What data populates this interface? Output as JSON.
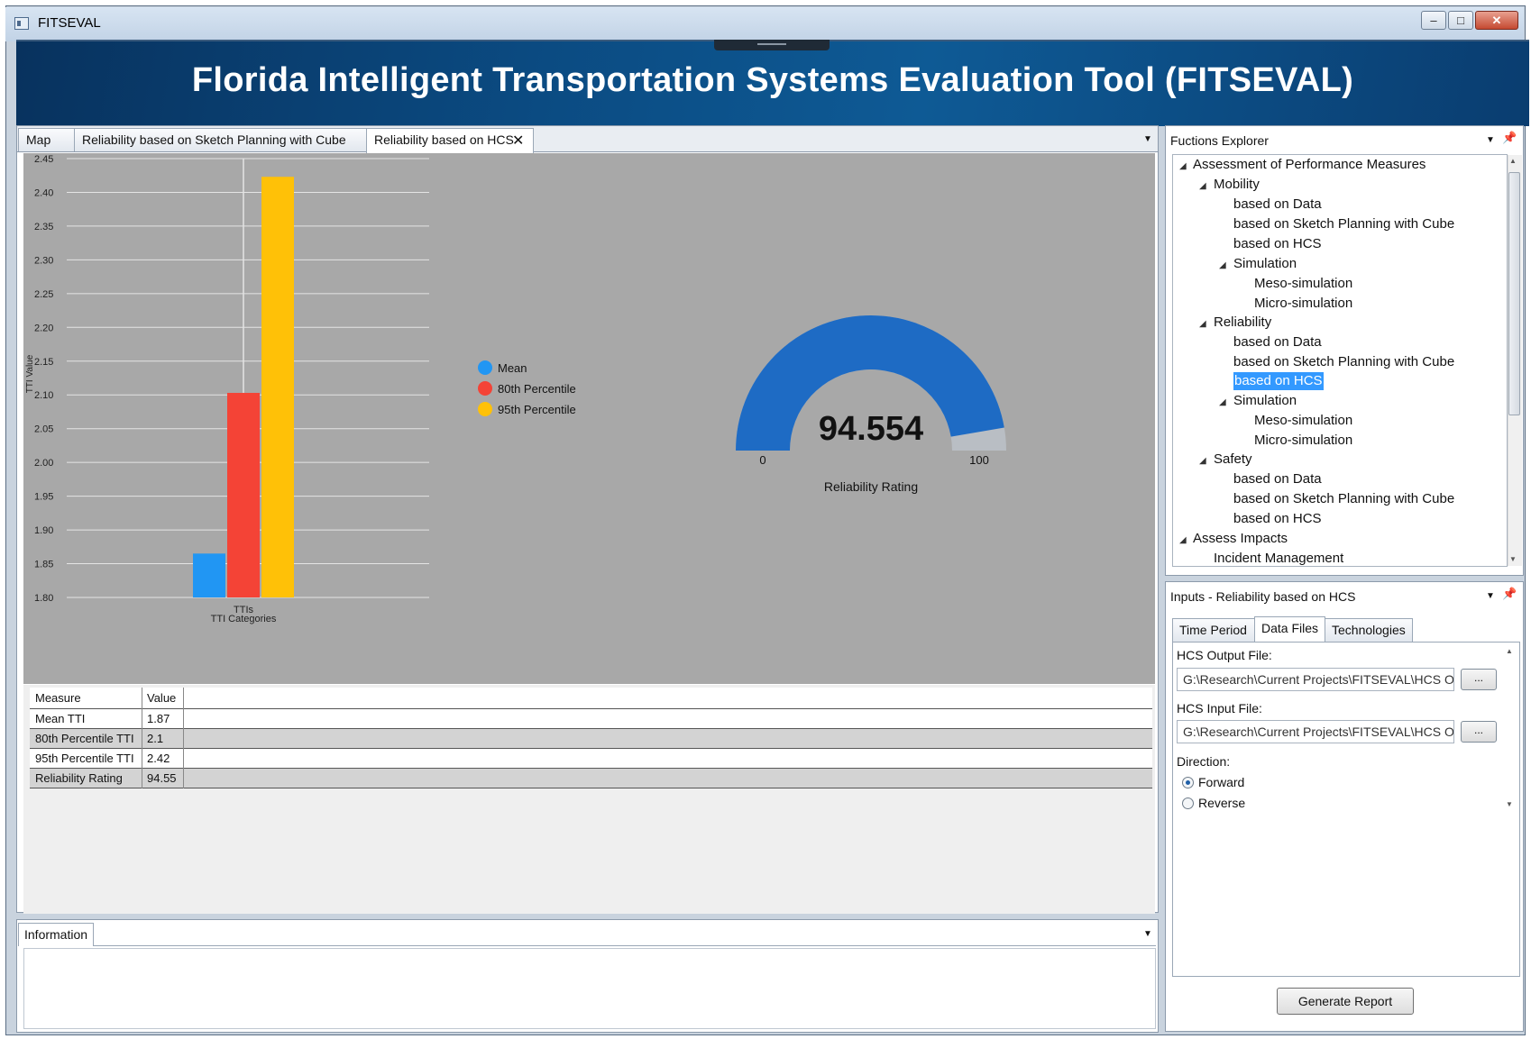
{
  "window": {
    "title": "FITSEVAL",
    "min_label": "‒",
    "max_label": "□",
    "close_label": "✕"
  },
  "banner": {
    "title": "Florida Intelligent Transportation Systems Evaluation Tool (FITSEVAL)"
  },
  "main_tabs": [
    {
      "label": "Map"
    },
    {
      "label": "Reliability based on Sketch Planning with Cube"
    },
    {
      "label": "Reliability based on HCS"
    }
  ],
  "icons": {
    "close": "close-icon",
    "dropdown": "dropdown-icon",
    "pin": "pin-icon"
  },
  "chart_data": {
    "type": "bar",
    "categories": [
      "TTIs"
    ],
    "series": [
      {
        "name": "Mean",
        "values": [
          1.865
        ],
        "color": "#2196f3"
      },
      {
        "name": "80th Percentile",
        "values": [
          2.103
        ],
        "color": "#f44336"
      },
      {
        "name": "95th Percentile",
        "values": [
          2.423
        ],
        "color": "#ffc107"
      }
    ],
    "ylabel": "TTI Value",
    "xlabel": "TTI Categories",
    "ylim": [
      1.8,
      2.45
    ],
    "yticks": [
      "2.45",
      "2.40",
      "2.35",
      "2.30",
      "2.25",
      "2.20",
      "2.15",
      "2.10",
      "2.05",
      "2.00",
      "1.95",
      "1.90",
      "1.85",
      "1.80"
    ],
    "grid": true,
    "legend_placement": "right"
  },
  "gauge": {
    "value_label": "94.554",
    "value": 94.554,
    "min": 0,
    "max": 100,
    "min_label": "0",
    "max_label": "100",
    "caption": "Reliability Rating",
    "fill_color": "#1e6bc4",
    "track_color": "#b9bec4"
  },
  "grid": {
    "columns": [
      "Measure",
      "Value"
    ],
    "rows": [
      {
        "measure": "Mean TTI",
        "value": "1.87"
      },
      {
        "measure": "80th Percentile TTI",
        "value": "2.1"
      },
      {
        "measure": "95th Percentile TTI",
        "value": "2.42"
      },
      {
        "measure": "Reliability Rating",
        "value": "94.55"
      }
    ]
  },
  "info_panel": {
    "tab_label": "Information"
  },
  "explorer": {
    "title": "Fuctions Explorer",
    "items": [
      {
        "label": "Assessment of Performance Measures"
      },
      {
        "label": "Mobility"
      },
      {
        "label": "based on Data"
      },
      {
        "label": "based on Sketch Planning with Cube"
      },
      {
        "label": "based on HCS"
      },
      {
        "label": "Simulation"
      },
      {
        "label": "Meso-simulation"
      },
      {
        "label": "Micro-simulation"
      },
      {
        "label": "Reliability"
      },
      {
        "label": "based on Data"
      },
      {
        "label": "based on Sketch Planning with Cube"
      },
      {
        "label": "based on HCS"
      },
      {
        "label": "Simulation"
      },
      {
        "label": "Meso-simulation"
      },
      {
        "label": "Micro-simulation"
      },
      {
        "label": "Safety"
      },
      {
        "label": "based on Data"
      },
      {
        "label": "based on Sketch Planning with Cube"
      },
      {
        "label": "based on HCS"
      },
      {
        "label": "Assess Impacts"
      },
      {
        "label": "Incident Management"
      }
    ]
  },
  "inputs": {
    "title": "Inputs - Reliability based on HCS",
    "tabs": [
      {
        "label": "Time Period"
      },
      {
        "label": "Data Files"
      },
      {
        "label": "Technologies"
      }
    ],
    "hcs_output_label": "HCS Output File:",
    "hcs_output_value": "G:\\Research\\Current Projects\\FITSEVAL\\HCS Out",
    "hcs_input_label": "HCS Input File:",
    "hcs_input_value": "G:\\Research\\Current Projects\\FITSEVAL\\HCS Out",
    "browse_label": "...",
    "direction_label": "Direction:",
    "direction_options": [
      {
        "label": "Forward",
        "selected": true
      },
      {
        "label": "Reverse",
        "selected": false
      }
    ],
    "generate_label": "Generate Report"
  }
}
